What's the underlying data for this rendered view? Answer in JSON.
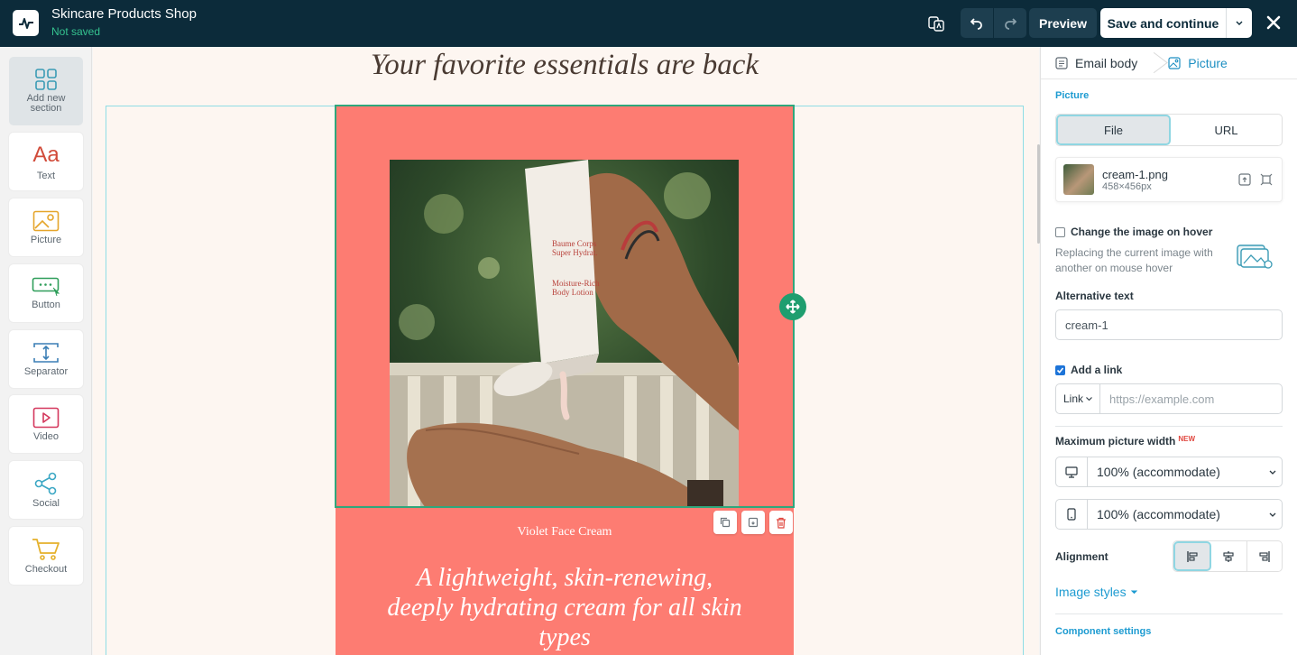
{
  "app": {
    "title": "Skincare Products Shop",
    "status": "Not saved"
  },
  "toolbar": {
    "preview_label": "Preview",
    "save_label": "Save and continue"
  },
  "sidebar": {
    "items": [
      {
        "label": "Add new section",
        "icon": "grid-icon"
      },
      {
        "label": "Text",
        "icon": "text-icon"
      },
      {
        "label": "Picture",
        "icon": "picture-icon"
      },
      {
        "label": "Button",
        "icon": "button-icon"
      },
      {
        "label": "Separator",
        "icon": "separator-icon"
      },
      {
        "label": "Video",
        "icon": "video-icon"
      },
      {
        "label": "Social",
        "icon": "social-icon"
      },
      {
        "label": "Checkout",
        "icon": "cart-icon"
      }
    ]
  },
  "canvas": {
    "headline": "Your favorite essentials are back",
    "product_name": "Violet Face Cream",
    "product_description": "A lightweight, skin-renewing, deeply hydrating cream for all skin types"
  },
  "panel": {
    "breadcrumbs": [
      "Email body",
      "Picture"
    ],
    "picture_section_title": "Picture",
    "source_tabs": [
      "File",
      "URL"
    ],
    "file_name": "cream-1.png",
    "file_dimensions": "458×456px",
    "hover_label": "Change the image on hover",
    "hover_hint": "Replacing the current image with another on mouse hover",
    "alt_label": "Alternative text",
    "alt_value": "cream-1",
    "link_label": "Add a link",
    "link_type": "Link",
    "link_placeholder": "https://example.com",
    "max_width_label": "Maximum picture width",
    "new_badge": "NEW",
    "desktop_width": "100% (accommodate)",
    "mobile_width": "100% (accommodate)",
    "alignment_label": "Alignment",
    "image_styles_label": "Image styles",
    "component_settings_label": "Component settings"
  },
  "colors": {
    "topbar": "#0c2b3a",
    "accent": "#1d9bd1",
    "card": "#fd7c72",
    "selection": "#2ea77c",
    "status": "#35c28f"
  }
}
